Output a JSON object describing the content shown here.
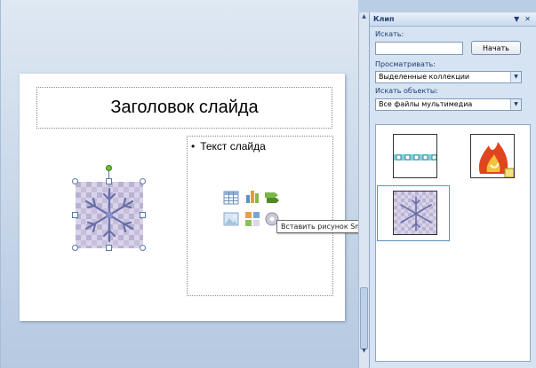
{
  "slide": {
    "title": "Заголовок слайда",
    "bullet": "Текст слайда",
    "tooltip": "Вставить рисунок SmartArt"
  },
  "icons": {
    "insert": [
      "table-icon",
      "chart-icon",
      "smartart-icon",
      "picture-icon",
      "clipart-icon",
      "media-icon"
    ]
  },
  "pane": {
    "title": "Клип",
    "search_label": "Искать:",
    "search_value": "",
    "go_button": "Начать",
    "browse_label": "Просматривать:",
    "browse_value": "Выделенные коллекции",
    "objects_label": "Искать объекты:",
    "objects_value": "Все файлы мультимедиа",
    "results": [
      "border-clip",
      "fire-clip",
      "snowflake-clip"
    ]
  },
  "colors": {
    "accent": "#1f3f73",
    "snowflake": "#6a6fa8",
    "green_handle": "#6fbf3a"
  }
}
